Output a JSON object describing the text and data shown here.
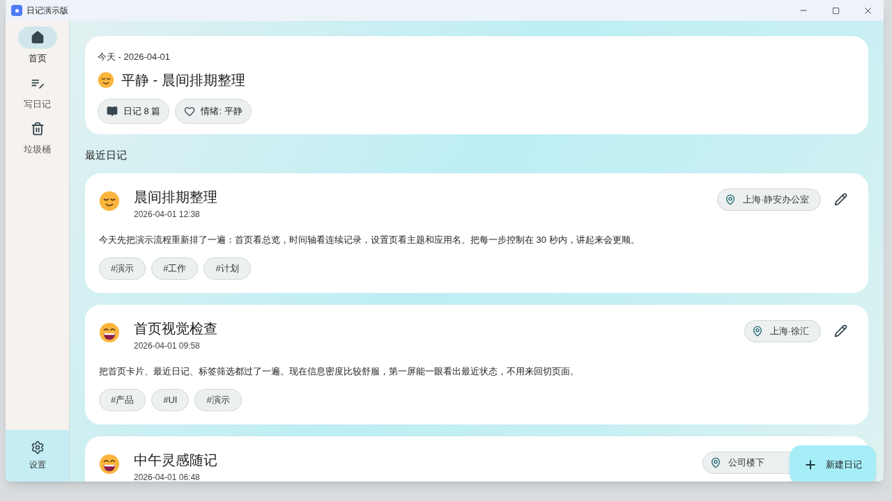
{
  "window": {
    "title": "日记演示版"
  },
  "sidebar": {
    "items": [
      {
        "label": "首页",
        "kind": "home",
        "selected": true
      },
      {
        "label": "写日记",
        "kind": "write",
        "selected": false
      },
      {
        "label": "垃圾桶",
        "kind": "trash",
        "selected": false
      }
    ],
    "settings": {
      "label": "设置"
    }
  },
  "today": {
    "kind": "calm",
    "date": "今天 - 2026-04-01",
    "title": "平静 - 晨间排期整理",
    "chips": [
      {
        "kind": "book",
        "label": "日记 8 篇"
      },
      {
        "kind": "heart",
        "label": "情绪: 平静"
      }
    ]
  },
  "section_title": "最近日记",
  "entries": [
    {
      "kind": "calm",
      "title": "晨间排期整理",
      "time": "2026-04-01 12:38",
      "location": "上海·静安办公室",
      "body": "今天先把演示流程重新排了一遍：首页看总览，时间轴看连续记录，设置页看主题和应用名。把每一步控制在 30 秒内，讲起来会更顺。",
      "tags": [
        "#演示",
        "#工作",
        "#计划"
      ]
    },
    {
      "kind": "happy",
      "title": "首页视觉检查",
      "time": "2026-04-01 09:58",
      "location": "上海·徐汇",
      "body": "把首页卡片、最近日记、标签筛选都过了一遍。现在信息密度比较舒服，第一屏能一眼看出最近状态，不用来回切页面。",
      "tags": [
        "#产品",
        "#UI",
        "#演示"
      ]
    },
    {
      "kind": "happy",
      "title": "中午灵感随记",
      "time": "2026-04-01 06:48",
      "location": "公司楼下",
      "location_cut": true
    }
  ],
  "fab": {
    "label": "新建日记"
  }
}
